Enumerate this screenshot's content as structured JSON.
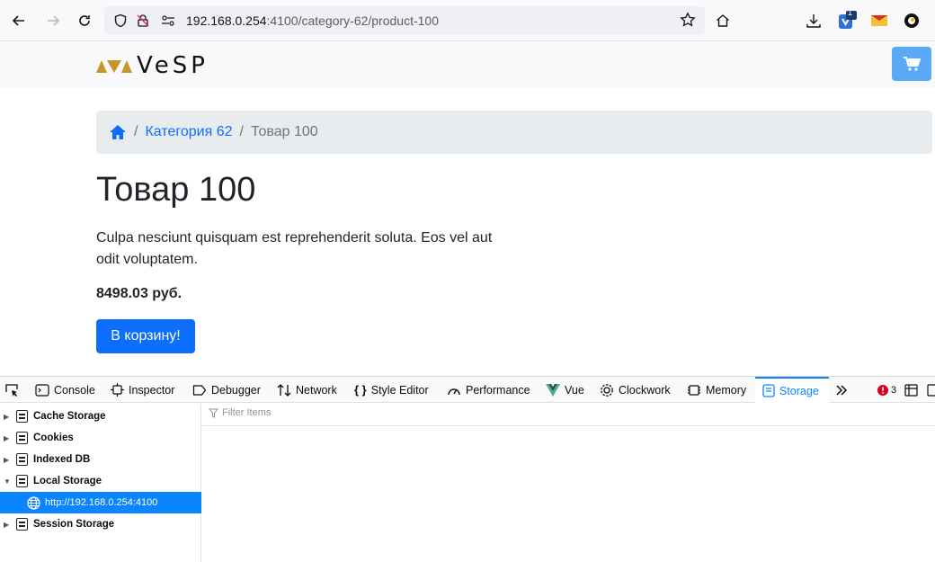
{
  "browser": {
    "url_host": "192.168.0.254",
    "url_rest": ":4100/category-62/product-100",
    "extension_badge": "1"
  },
  "site": {
    "logo_text": "VeSP",
    "colors": {
      "logo_gold": "#c8952b",
      "cart": "#5aa9f5",
      "primary": "#0d6efd"
    }
  },
  "breadcrumb": {
    "category": "Категория 62",
    "current": "Товар 100",
    "separator": "/"
  },
  "product": {
    "title": "Товар 100",
    "description": "Culpa nesciunt quisquam est reprehenderit soluta. Eos vel aut odit voluptatem.",
    "price": "8498.03 руб.",
    "add_button": "В корзину!"
  },
  "devtools": {
    "tabs": [
      {
        "label": "Console",
        "icon": "console-icon"
      },
      {
        "label": "Inspector",
        "icon": "inspector-icon"
      },
      {
        "label": "Debugger",
        "icon": "debugger-icon"
      },
      {
        "label": "Network",
        "icon": "network-icon"
      },
      {
        "label": "Style Editor",
        "icon": "style-editor-icon"
      },
      {
        "label": "Performance",
        "icon": "performance-icon"
      },
      {
        "label": "Vue",
        "icon": "vue-icon"
      },
      {
        "label": "Clockwork",
        "icon": "clockwork-icon"
      },
      {
        "label": "Memory",
        "icon": "memory-icon"
      },
      {
        "label": "Storage",
        "icon": "storage-icon"
      }
    ],
    "error_count": "3",
    "filter_placeholder": "Filter Items",
    "tree": [
      {
        "label": "Cache Storage",
        "expanded": false
      },
      {
        "label": "Cookies",
        "expanded": false
      },
      {
        "label": "Indexed DB",
        "expanded": false
      },
      {
        "label": "Local Storage",
        "expanded": true
      },
      {
        "label": "http://192.168.0.254:4100",
        "selected": true
      },
      {
        "label": "Session Storage",
        "expanded": false
      }
    ]
  }
}
